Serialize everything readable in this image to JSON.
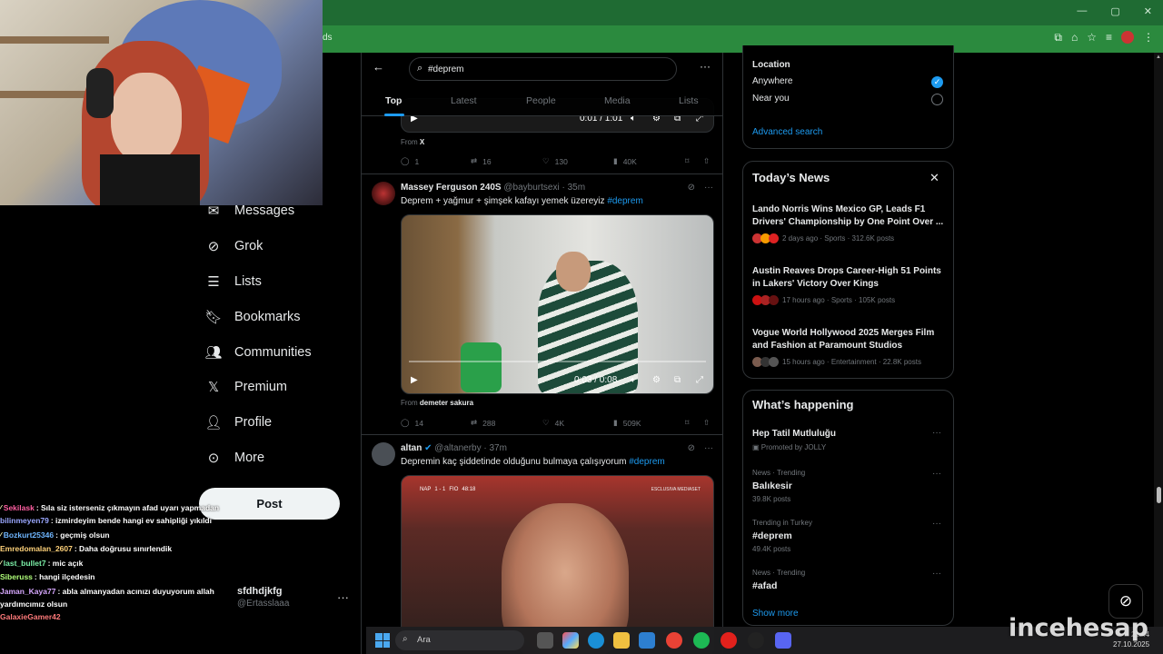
{
  "browser": {
    "address_text": "ds",
    "window_controls": [
      "—",
      "▢",
      "✕"
    ]
  },
  "search": {
    "query": "#deprem",
    "placeholder": "Search"
  },
  "tabs": [
    {
      "label": "Top",
      "active": true
    },
    {
      "label": "Latest",
      "active": false
    },
    {
      "label": "People",
      "active": false
    },
    {
      "label": "Media",
      "active": false
    },
    {
      "label": "Lists",
      "active": false
    }
  ],
  "nav": {
    "items": [
      {
        "label": "Messages",
        "icon": "envelope-icon"
      },
      {
        "label": "Grok",
        "icon": "grok-icon"
      },
      {
        "label": "Lists",
        "icon": "list-icon"
      },
      {
        "label": "Bookmarks",
        "icon": "bookmark-icon"
      },
      {
        "label": "Communities",
        "icon": "communities-icon"
      },
      {
        "label": "Premium",
        "icon": "x-icon"
      },
      {
        "label": "Profile",
        "icon": "person-icon"
      },
      {
        "label": "More",
        "icon": "more-circle-icon"
      }
    ],
    "post_label": "Post"
  },
  "account": {
    "name": "sfdhdjkfg",
    "handle": "@Ertasslaaa"
  },
  "tweets": [
    {
      "video_time": "0:01 / 1:01",
      "from_label": "From",
      "from_source": "X",
      "replies": "1",
      "reposts": "16",
      "likes": "130",
      "views": "40K"
    },
    {
      "name": "Massey Ferguson 240S",
      "handle": "@bayburtsexi · 35m",
      "text": "Deprem + yağmur + şimşek kafayı yemek üzereyiz ",
      "tag": "#deprem",
      "video_time": "0:03 / 0:08",
      "from_label": "From",
      "from_source": "demeter sakura",
      "replies": "14",
      "reposts": "288",
      "likes": "4K",
      "views": "509K"
    },
    {
      "name": "altan",
      "handle": "@altanerby · 37m",
      "text": "Depremin kaç şiddetinde olduğunu bulmaya çalışıyorum ",
      "tag": "#deprem",
      "score": "1 - 1",
      "score_clock": "48:18",
      "score_teams": [
        "NAP",
        "FIO"
      ],
      "score_brand": "ESCLUSIVA MEDIASET"
    }
  ],
  "location": {
    "title": "Location",
    "options": [
      {
        "label": "Anywhere",
        "selected": true
      },
      {
        "label": "Near you",
        "selected": false
      }
    ],
    "advanced_link": "Advanced search"
  },
  "todays_news": {
    "title": "Today’s News",
    "items": [
      {
        "title": "Lando Norris Wins Mexico GP, Leads F1 Drivers' Championship by One Point Over ...",
        "meta": "2 days ago · Sports · 312.6K posts"
      },
      {
        "title": "Austin Reaves Drops Career-High 51 Points in Lakers' Victory Over Kings",
        "meta": "17 hours ago · Sports · 105K posts"
      },
      {
        "title": "Vogue World Hollywood 2025 Merges Film and Fashion at Paramount Studios",
        "meta": "15 hours ago · Entertainment · 22.8K posts"
      }
    ]
  },
  "whats_happening": {
    "title": "What’s happening",
    "items": [
      {
        "category": "",
        "name": "Hep Tatil Mutluluğu",
        "sub": "Promoted by JOLLY"
      },
      {
        "category": "News · Trending",
        "name": "Balıkesir",
        "sub": "39.8K posts"
      },
      {
        "category": "Trending in Turkey",
        "name": "#deprem",
        "sub": "49.4K posts"
      },
      {
        "category": "News · Trending",
        "name": "#afad",
        "sub": ""
      }
    ],
    "show_more": "Show more"
  },
  "chat": [
    {
      "user": "Sekilask",
      "color": "#ff5fa2",
      "msg": ": Sıla siz isterseniz çıkmayın afad uyarı yapmadan"
    },
    {
      "user": "bilinmeyen79",
      "color": "#9aa7ff",
      "msg": ": izmirdeyim bende hangi ev sahipliği yıkıldı"
    },
    {
      "user": "Bozkurt25346",
      "color": "#6fb6ff",
      "msg": ": geçmiş olsun"
    },
    {
      "user": "Emredomalan_2607",
      "color": "#ffd27a",
      "msg": ": Daha doğrusu sınırlendik"
    },
    {
      "user": "last_bullet7",
      "color": "#7cf0a8",
      "msg": ": mic açık"
    },
    {
      "user": "Siberuss",
      "color": "#b0ff7a",
      "msg": ": hangi ilçedesin"
    },
    {
      "user": "Jaman_Kaya77",
      "color": "#d7a8ff",
      "msg": ": abla almanyadan acınızı duyuyorum allah yardımcımız olsun"
    },
    {
      "user": "GalaxieGamer42",
      "color": "#ff7a7a",
      "msg": ""
    }
  ],
  "taskbar": {
    "search_placeholder": "Ara",
    "time": "21:44",
    "date": "27.10.2025"
  },
  "watermark": "incehesap",
  "colors": {
    "accent": "#1d9bf0",
    "chrome": "#2b8a3e"
  }
}
